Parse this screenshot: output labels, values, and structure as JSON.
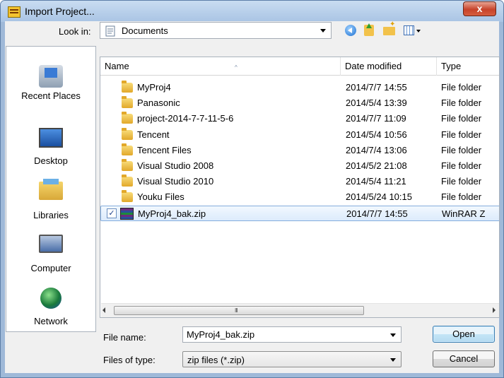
{
  "window": {
    "title": "Import Project...",
    "close_glyph": "x"
  },
  "toolbar": {
    "look_in_label": "Look in:",
    "look_in_value": "Documents",
    "icons": [
      "back-icon",
      "up-folder-icon",
      "new-folder-icon",
      "view-menu-icon"
    ]
  },
  "places": [
    {
      "label": "Recent Places",
      "icon": "recent-places-icon"
    },
    {
      "label": "Desktop",
      "icon": "desktop-icon"
    },
    {
      "label": "Libraries",
      "icon": "libraries-icon"
    },
    {
      "label": "Computer",
      "icon": "computer-icon"
    },
    {
      "label": "Network",
      "icon": "network-icon"
    }
  ],
  "columns": {
    "name": "Name",
    "date": "Date modified",
    "type": "Type",
    "sort_glyph": "^"
  },
  "files": [
    {
      "name": "MyProj4",
      "date": "2014/7/7 14:55",
      "type": "File folder",
      "kind": "folder"
    },
    {
      "name": "Panasonic",
      "date": "2014/5/4 13:39",
      "type": "File folder",
      "kind": "folder"
    },
    {
      "name": "project-2014-7-7-11-5-6",
      "date": "2014/7/7 11:09",
      "type": "File folder",
      "kind": "folder"
    },
    {
      "name": "Tencent",
      "date": "2014/5/4 10:56",
      "type": "File folder",
      "kind": "folder"
    },
    {
      "name": "Tencent Files",
      "date": "2014/7/4 13:06",
      "type": "File folder",
      "kind": "folder"
    },
    {
      "name": "Visual Studio 2008",
      "date": "2014/5/2 21:08",
      "type": "File folder",
      "kind": "folder"
    },
    {
      "name": "Visual Studio 2010",
      "date": "2014/5/4 11:21",
      "type": "File folder",
      "kind": "folder"
    },
    {
      "name": "Youku Files",
      "date": "2014/5/24 10:15",
      "type": "File folder",
      "kind": "folder"
    },
    {
      "name": "MyProj4_bak.zip",
      "date": "2014/7/7 14:55",
      "type": "WinRAR Z",
      "kind": "zip",
      "selected": true,
      "checked": true
    }
  ],
  "scrollbar": {
    "grip": "III"
  },
  "form": {
    "file_name_label": "File name:",
    "file_name_value": "MyProj4_bak.zip",
    "file_type_label": "Files of type:",
    "file_type_value": "zip files (*.zip)"
  },
  "buttons": {
    "open": "Open",
    "cancel": "Cancel"
  }
}
